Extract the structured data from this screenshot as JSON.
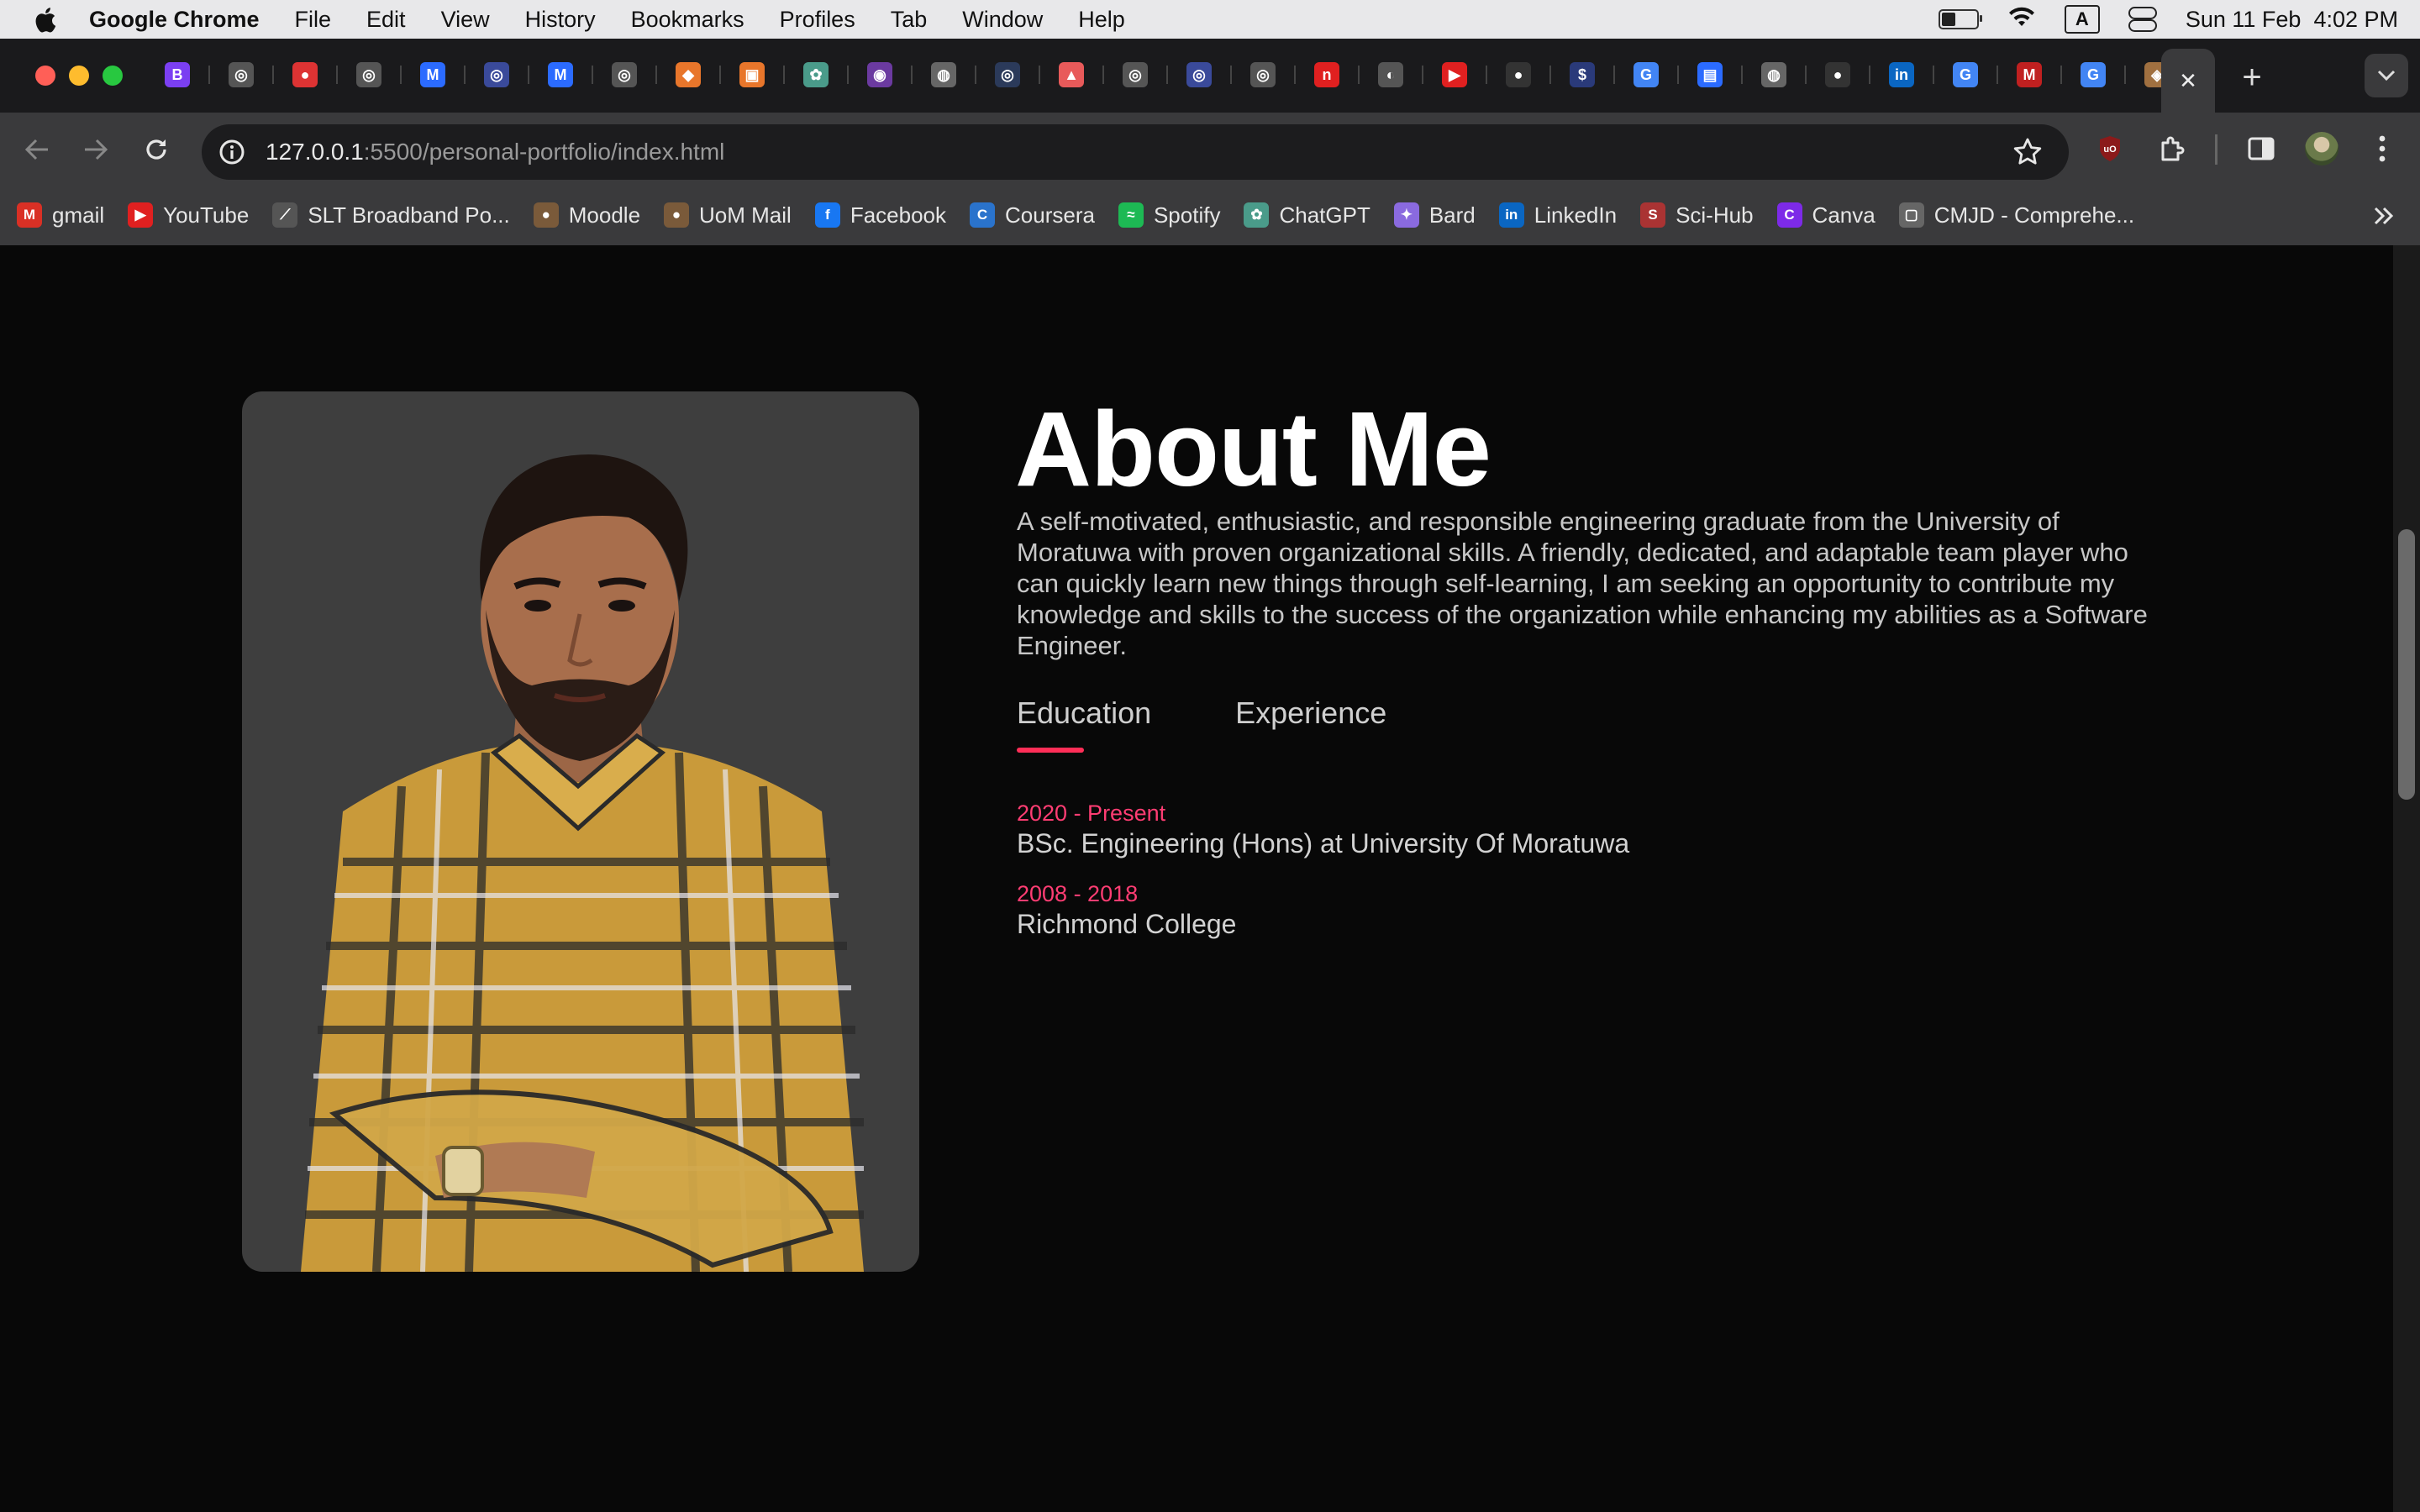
{
  "menubar": {
    "app_name": "Google Chrome",
    "items": [
      "File",
      "Edit",
      "View",
      "History",
      "Bookmarks",
      "Profiles",
      "Tab",
      "Window",
      "Help"
    ],
    "input_indicator": "A",
    "datetime": "Sun 11 Feb  4:02 PM"
  },
  "browser": {
    "url_host": "127.0.0.1",
    "url_path": ":5500/personal-portfolio/index.html",
    "tab_close": "✕",
    "new_tab": "+",
    "tab_favicons": [
      {
        "label": "B",
        "color": "#7b3ff2"
      },
      {
        "label": "◎",
        "color": "#555"
      },
      {
        "label": "●",
        "color": "#d33"
      },
      {
        "label": "◎",
        "color": "#555"
      },
      {
        "label": "M",
        "color": "#2b6bff"
      },
      {
        "label": "◎",
        "color": "#3a4a9a"
      },
      {
        "label": "M",
        "color": "#2b6bff"
      },
      {
        "label": "◎",
        "color": "#555"
      },
      {
        "label": "◆",
        "color": "#e8762b"
      },
      {
        "label": "▣",
        "color": "#e8762b"
      },
      {
        "label": "✿",
        "color": "#4a9b8a"
      },
      {
        "label": "◉",
        "color": "#6b3aa0"
      },
      {
        "label": "◍",
        "color": "#666"
      },
      {
        "label": "◎",
        "color": "#2b3a5a"
      },
      {
        "label": "▲",
        "color": "#e85a5a"
      },
      {
        "label": "◎",
        "color": "#555"
      },
      {
        "label": "◎",
        "color": "#3a4a9a"
      },
      {
        "label": "◎",
        "color": "#555"
      },
      {
        "label": "n",
        "color": "#e02020"
      },
      {
        "label": "◐",
        "color": "#555"
      },
      {
        "label": "▶",
        "color": "#e02020"
      },
      {
        "label": "●",
        "color": "#333"
      },
      {
        "label": "$",
        "color": "#2a3a7a"
      },
      {
        "label": "G",
        "color": "#4285f4"
      },
      {
        "label": "▤",
        "color": "#2b6bff"
      },
      {
        "label": "◍",
        "color": "#666"
      },
      {
        "label": "●",
        "color": "#333"
      },
      {
        "label": "in",
        "color": "#0a66c2"
      },
      {
        "label": "G",
        "color": "#4285f4"
      },
      {
        "label": "M",
        "color": "#c02020"
      },
      {
        "label": "G",
        "color": "#4285f4"
      },
      {
        "label": "◈",
        "color": "#a07040"
      }
    ]
  },
  "bookmarks": [
    {
      "label": "gmail",
      "icon": "M",
      "color": "#d93025"
    },
    {
      "label": "YouTube",
      "icon": "▶",
      "color": "#e02020"
    },
    {
      "label": "SLT Broadband Po...",
      "icon": "⟋",
      "color": "#555"
    },
    {
      "label": "Moodle",
      "icon": "●",
      "color": "#7a5a3a"
    },
    {
      "label": "UoM Mail",
      "icon": "●",
      "color": "#7a5a3a"
    },
    {
      "label": "Facebook",
      "icon": "f",
      "color": "#1877f2"
    },
    {
      "label": "Coursera",
      "icon": "C",
      "color": "#2a73cc"
    },
    {
      "label": "Spotify",
      "icon": "≈",
      "color": "#1db954"
    },
    {
      "label": "ChatGPT",
      "icon": "✿",
      "color": "#4a9b8a"
    },
    {
      "label": "Bard",
      "icon": "✦",
      "color": "#8a6adf"
    },
    {
      "label": "LinkedIn",
      "icon": "in",
      "color": "#0a66c2"
    },
    {
      "label": "Sci-Hub",
      "icon": "S",
      "color": "#a33"
    },
    {
      "label": "Canva",
      "icon": "C",
      "color": "#7d2ae8"
    },
    {
      "label": "CMJD - Comprehe...",
      "icon": "▢",
      "color": "#666"
    }
  ],
  "about": {
    "title": "About Me",
    "text": "A self-motivated, enthusiastic, and responsible engineering graduate from the University of Moratuwa with proven organizational skills. A friendly, dedicated, and adaptable team player who can quickly learn new things through self-learning, I am seeking an opportunity to contribute my knowledge and skills to the success of the organization while enhancing my abilities as a Software Engineer.",
    "tabs": [
      "Education",
      "Experience"
    ],
    "education": [
      {
        "date": "2020 - Present",
        "name": "BSc. Engineering (Hons) at University Of Moratuwa"
      },
      {
        "date": "2008 - 2018",
        "name": "Richmond College"
      }
    ]
  },
  "colors": {
    "accent": "#ff2e57",
    "date": "#ff3d73",
    "background": "#080808",
    "card": "#3e3e3e"
  }
}
